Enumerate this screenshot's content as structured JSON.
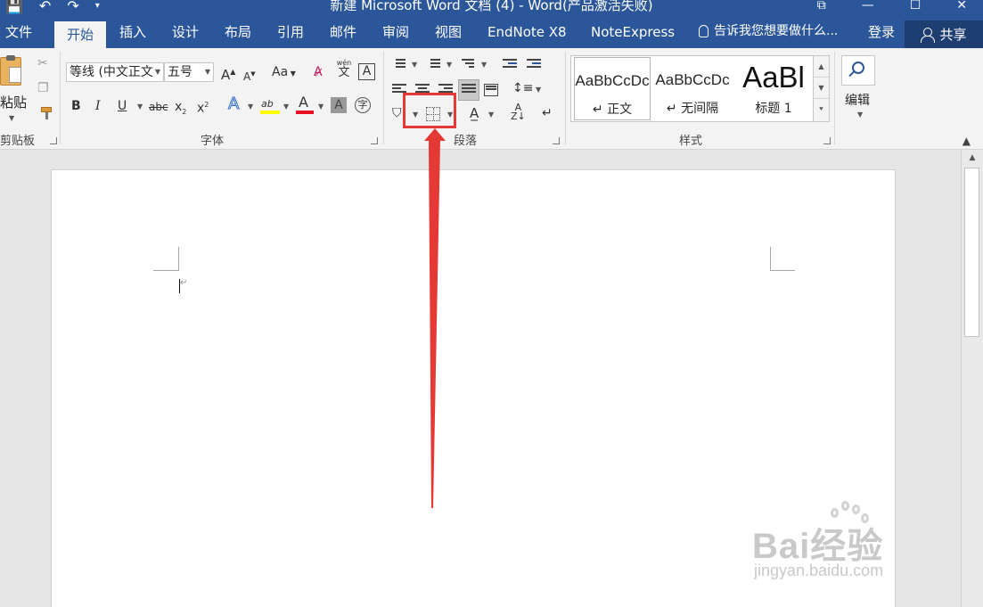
{
  "window": {
    "title": "新建 Microsoft Word 文档 (4) - Word(产品激活失败)",
    "controls": [
      "⧉",
      "—",
      "☐",
      "✕"
    ]
  },
  "tabs": [
    "文件",
    "开始",
    "插入",
    "设计",
    "布局",
    "引用",
    "邮件",
    "审阅",
    "视图",
    "EndNote X8",
    "NoteExpress"
  ],
  "active_tab": "开始",
  "tell_me": "告诉我您想要做什么...",
  "login": "登录",
  "share": "共享",
  "clipboard": {
    "paste": "粘贴",
    "label": "剪贴板"
  },
  "font": {
    "name": "等线 (中文正文",
    "size": "五号",
    "grow": "A",
    "shrink": "A",
    "case": "Aa",
    "phonetic_top": "wén",
    "phonetic_bottom": "文",
    "border_char": "A",
    "bold": "B",
    "italic": "I",
    "underline": "U",
    "strike": "abc",
    "subscript": "x",
    "superscript": "x",
    "effects": "A",
    "highlight": "ab",
    "font_color": "A",
    "shading": "A",
    "enclose": "字",
    "label": "字体",
    "highlight_color": "#ffff00",
    "font_color_value": "#e81123"
  },
  "paragraph": {
    "label": "段落"
  },
  "styles": {
    "label": "样式",
    "items": [
      {
        "sample": "AaBbCcDc",
        "name": "↵ 正文"
      },
      {
        "sample": "AaBbCcDc",
        "name": "↵ 无间隔"
      },
      {
        "sample": "AaBl",
        "name": "标题 1"
      }
    ]
  },
  "editing": {
    "label": "编辑"
  },
  "document": {
    "paragraph_mark": "↵"
  },
  "watermark": {
    "brand": "Bai经验",
    "url": "jingyan.baidu.com"
  },
  "colors": {
    "accent": "#2b579a",
    "annotation": "#e53935"
  }
}
